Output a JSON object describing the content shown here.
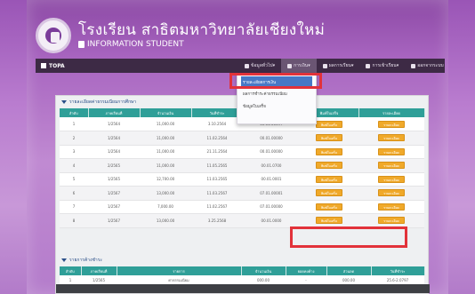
{
  "header": {
    "school_name": "โรงเรียน สาธิตมหาวิทยาลัยเชียงใหม่",
    "subtitle": "INFORMATION STUDENT"
  },
  "navbar": {
    "brand": "TOPA",
    "items": [
      {
        "label": "ข้อมูลทั่วไป",
        "icon": "user-icon"
      },
      {
        "label": "การเงิน",
        "icon": "wallet-icon"
      },
      {
        "label": "ผลการเรียน",
        "icon": "book-icon"
      },
      {
        "label": "การเข้าเรียน",
        "icon": "calendar-icon"
      },
      {
        "label": "ออกจากระบบ",
        "icon": "logout-icon"
      }
    ]
  },
  "dropdown": {
    "items": [
      {
        "label": "รายละเอียดการเงิน"
      },
      {
        "label": "ผลการชำระค่าธรรมเนียม"
      },
      {
        "label": "ข้อมูลใบเสร็จ"
      }
    ]
  },
  "section1": {
    "title": "รายละเอียดค่าธรรมเนียมการศึกษา",
    "columns": [
      "ลำดับ",
      "ภาคเรียนที่",
      "จำนวนเงิน",
      "วันที่ชำระ",
      "เลขที่ใบเสร็จ",
      "พิมพ์ใบเสร็จ",
      "รายละเอียด"
    ],
    "rows": [
      {
        "no": "1",
        "term": "1/2564",
        "amount": "11,000.00",
        "date": "3.10.2564",
        "receipt": "00.01.00097",
        "print": "พิมพ์ใบเสร็จ",
        "detail": "รายละเอียด"
      },
      {
        "no": "2",
        "term": "1/2564",
        "amount": "11,000.00",
        "date": "11.02.2564",
        "receipt": "00.01.00000",
        "print": "พิมพ์ใบเสร็จ",
        "detail": "รายละเอียด"
      },
      {
        "no": "3",
        "term": "1/2564",
        "amount": "11,000.00",
        "date": "21.11.2564",
        "receipt": "00.01.00000",
        "print": "พิมพ์ใบเสร็จ",
        "detail": "รายละเอียด"
      },
      {
        "no": "4",
        "term": "2/2565",
        "amount": "11,000.00",
        "date": "11.05.2565",
        "receipt": "00.01.0700",
        "print": "พิมพ์ใบเสร็จ",
        "detail": "รายละเอียด"
      },
      {
        "no": "5",
        "term": "1/2565",
        "amount": "12,700.00",
        "date": "11.03.2565",
        "receipt": "00.01.0001",
        "print": "พิมพ์ใบเสร็จ",
        "detail": "รายละเอียด"
      },
      {
        "no": "6",
        "term": "1/2567",
        "amount": "13,000.00",
        "date": "11.03.2567",
        "receipt": "07.01.00001",
        "print": "พิมพ์ใบเสร็จ",
        "detail": "รายละเอียด"
      },
      {
        "no": "7",
        "term": "1/2567",
        "amount": "7,000.00",
        "date": "11.02.2567",
        "receipt": "07.01.00000",
        "print": "พิมพ์ใบเสร็จ",
        "detail": "รายละเอียด"
      },
      {
        "no": "8",
        "term": "1/2567",
        "amount": "13,000.00",
        "date": "3.25.2568",
        "receipt": "00.01.0000",
        "print": "พิมพ์ใบเสร็จ",
        "detail": "รายละเอียด"
      }
    ]
  },
  "section2": {
    "title": "รายการค้างชำระ",
    "columns": [
      "ลำดับ",
      "ภาคเรียนที่",
      "รายการ",
      "จำนวนเงิน",
      "ยอดคงค้าง",
      "ส่วนลด",
      "วันที่ชำระ"
    ],
    "rows": [
      {
        "no": "1",
        "term": "1/2565",
        "item": "ค่าธรรมเนียม",
        "amount": "000.00",
        "outstanding": "-",
        "discount": "000.00",
        "date": "25.6-2.0797"
      }
    ]
  }
}
